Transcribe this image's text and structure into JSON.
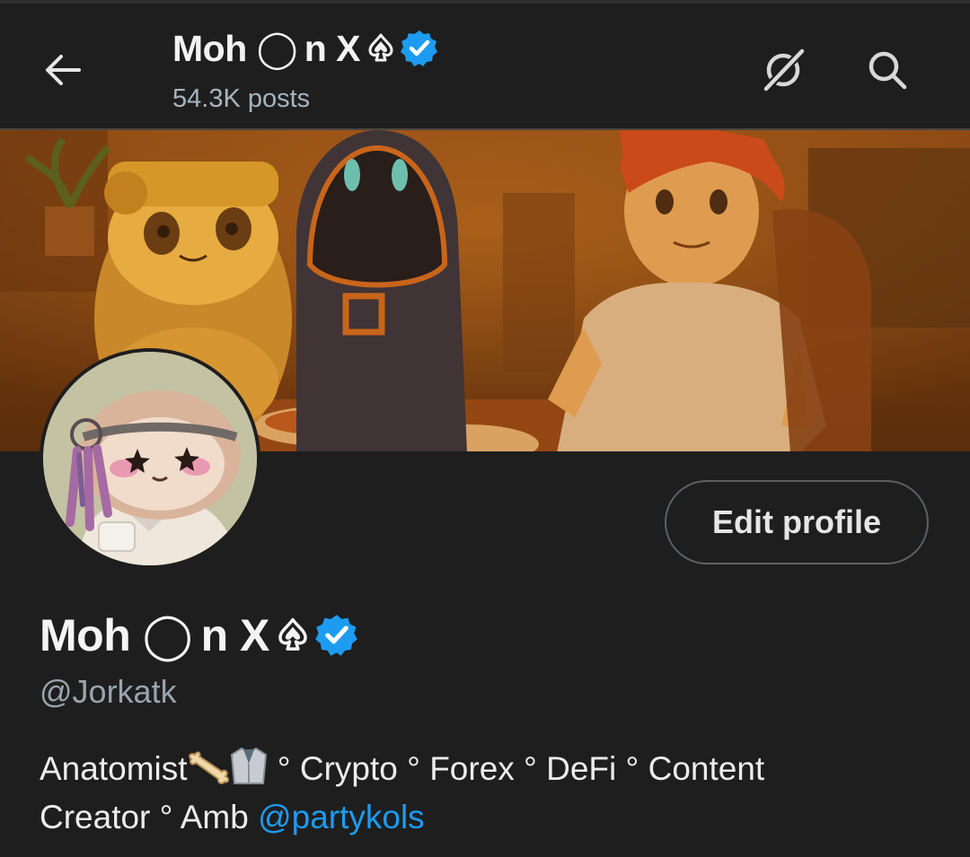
{
  "header": {
    "title": "Moh ◯ n X",
    "posts_count": "54.3K posts"
  },
  "profile": {
    "display_name": "Moh ◯ n X",
    "handle": "@Jorkatk",
    "edit_label": "Edit profile",
    "bio_line1": "Anatomist",
    "bio_line1_rest": " ° Crypto ° Forex ° DeFi ° Content",
    "bio_line2": "Creator ° Amb ",
    "bio_mention": "@partykols",
    "bio_emojis": [
      "bone",
      "lab-coat"
    ]
  },
  "colors": {
    "background": "#1e1e1f",
    "accent": "#1d9bf0",
    "secondary_text": "#9aa4ad",
    "verified": "#1d9bf0"
  },
  "icons": {
    "back": "back-arrow-icon",
    "grok": "grok-icon",
    "search": "search-icon",
    "spade": "spade-icon",
    "verified": "verified-badge-icon"
  }
}
